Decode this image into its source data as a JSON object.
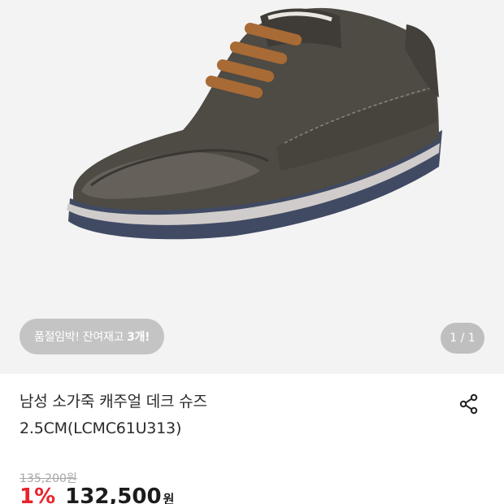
{
  "gallery": {
    "image_alt": "남성 소가죽 캐주얼 데크 슈즈",
    "stock_label": "품절임박! 잔여재고",
    "stock_count": "3개!",
    "page_counter": "1 / 1"
  },
  "product": {
    "title_line1": "남성 소가죽 캐주얼 데크 슈즈",
    "title_line2": "2.5CM(LCMC61U313)"
  },
  "price": {
    "original": "135,200원",
    "discount": "1%",
    "sale": "132,500",
    "currency": "원"
  },
  "icons": {
    "share": "share-icon"
  },
  "colors": {
    "discount": "#e8232a",
    "pill_bg": "#c4c4c4"
  }
}
